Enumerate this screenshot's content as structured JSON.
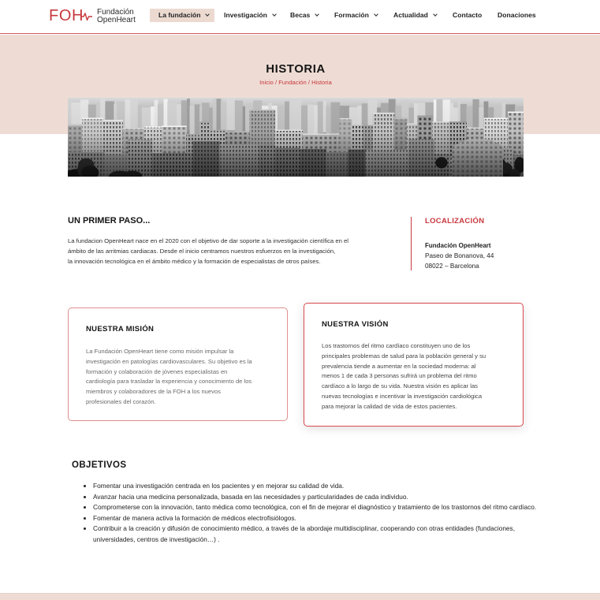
{
  "colors": {
    "accent": "#c8383e",
    "hero_background": "#eedcd4",
    "active_nav_background": "#ecdad1",
    "text": "#1e1e1e"
  },
  "header": {
    "logo": {
      "mark": "FOH",
      "line1": "Fundación",
      "line2": "OpenHeart"
    },
    "nav": [
      {
        "label": "La fundación",
        "dropdown": true,
        "active": true
      },
      {
        "label": "Investigación",
        "dropdown": true,
        "active": false
      },
      {
        "label": "Becas",
        "dropdown": true,
        "active": false
      },
      {
        "label": "Formación",
        "dropdown": true,
        "active": false
      },
      {
        "label": "Actualidad",
        "dropdown": true,
        "active": false
      },
      {
        "label": "Contacto",
        "dropdown": false,
        "active": false
      },
      {
        "label": "Donaciones",
        "dropdown": false,
        "active": false
      }
    ],
    "dropdown_icon": "chevron-down-icon"
  },
  "hero": {
    "title": "HISTORIA",
    "breadcrumb": [
      "Inicio",
      "Fundación",
      "Historia"
    ],
    "breadcrumb_separator": "/"
  },
  "primer_paso": {
    "heading": "UN PRIMER PASO...",
    "lines": [
      "La fundacion OpenHeart nace en el 2020 con el objetivo de dar soporte a la investigación científica en el",
      "ámbito de las arritmias cardiacas. Desde el inicio centramos nuestros esfuerzos en la investigación,",
      "la innovación tecnológica en el ámbito médico y la formación de especialistas de otros países."
    ]
  },
  "localizacion": {
    "heading": "LOCALIZACIÓN",
    "name": "Fundación OpenHeart",
    "street": "Paseo de Bonanova, 44",
    "city": "08022 – Barcelona"
  },
  "mision": {
    "heading": "NUESTRA MISIÓN",
    "lines": [
      "La Fundación OpenHeart tiene como misión impulsar la",
      "investigación en patologías cardiovasculares. Su objetivo es la",
      "formación y colaboración de jóvenes especialistas en",
      "cardiología para trasladar la experiencia y conocimiento de los",
      "miembros y colaboradores de la FOH a los nuevos",
      "profesionales del corazón."
    ]
  },
  "vision": {
    "heading": "NUESTRA VISIÓN",
    "lines": [
      "Los trastornos del ritmo cardíaco constituyen uno de los",
      "principales problemas de salud para la población general y su",
      "prevalencia tiende a aumentar en la sociedad moderna: al",
      "menos 1 de cada 3 personas sufrirá un problema del ritmo",
      "cardíaco a lo largo de su vida. Nuestra visión es aplicar las",
      "nuevas tecnologías e incentivar la investigación cardiológica",
      "para mejorar la calidad de vida de estos pacientes."
    ]
  },
  "objetivos": {
    "heading": "OBJETIVOS",
    "items": [
      "Fomentar una investigación centrada en los pacientes y en mejorar su calidad de vida.",
      "Avanzar hacia una medicina personalizada, basada en las necesidades y particularidades de cada individuo.",
      "Comprometerse con la innovación, tanto médica como tecnológica, con el fin de mejorar el diagnóstico y tratamiento de los trastornos del ritmo cardíaco.",
      "Fomentar de manera activa la formación de médicos electrofisiólogos.",
      "Contribuir a la creación y difusión de conocimiento médico, a través de la abordaje multidisciplinar, cooperando con otras entidades (fundaciones, universidades, centros de investigación…) ."
    ]
  }
}
